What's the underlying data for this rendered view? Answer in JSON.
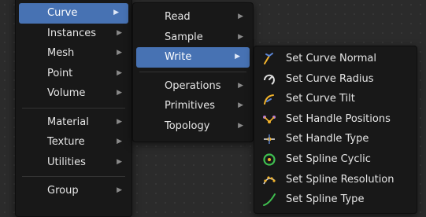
{
  "menu_level1": {
    "items": [
      {
        "label": "Curve",
        "active": true
      },
      {
        "label": "Instances"
      },
      {
        "label": "Mesh"
      },
      {
        "label": "Point"
      },
      {
        "label": "Volume"
      },
      {
        "label": "Material"
      },
      {
        "label": "Texture"
      },
      {
        "label": "Utilities"
      },
      {
        "label": "Group"
      }
    ]
  },
  "menu_level2": {
    "items": [
      {
        "label": "Read"
      },
      {
        "label": "Sample"
      },
      {
        "label": "Write",
        "active": true
      },
      {
        "label": "Operations"
      },
      {
        "label": "Primitives"
      },
      {
        "label": "Topology"
      }
    ]
  },
  "menu_level3": {
    "items": [
      {
        "label": "Set Curve Normal",
        "icon": "curve-normal-icon"
      },
      {
        "label": "Set Curve Radius",
        "icon": "curve-radius-icon"
      },
      {
        "label": "Set Curve Tilt",
        "icon": "curve-tilt-icon"
      },
      {
        "label": "Set Handle Positions",
        "icon": "handle-positions-icon"
      },
      {
        "label": "Set Handle Type",
        "icon": "handle-type-icon"
      },
      {
        "label": "Set Spline Cyclic",
        "icon": "spline-cyclic-icon"
      },
      {
        "label": "Set Spline Resolution",
        "icon": "spline-resolution-icon"
      },
      {
        "label": "Set Spline Type",
        "icon": "spline-type-icon"
      }
    ]
  },
  "colors": {
    "highlight": "#4772b3",
    "menu_bg": "#181818",
    "text": "#e6e6e6",
    "icon_yellow": "#f2b32c",
    "icon_blue": "#5d86d6",
    "icon_green": "#3fbf4f",
    "icon_purple": "#b57bd8"
  }
}
